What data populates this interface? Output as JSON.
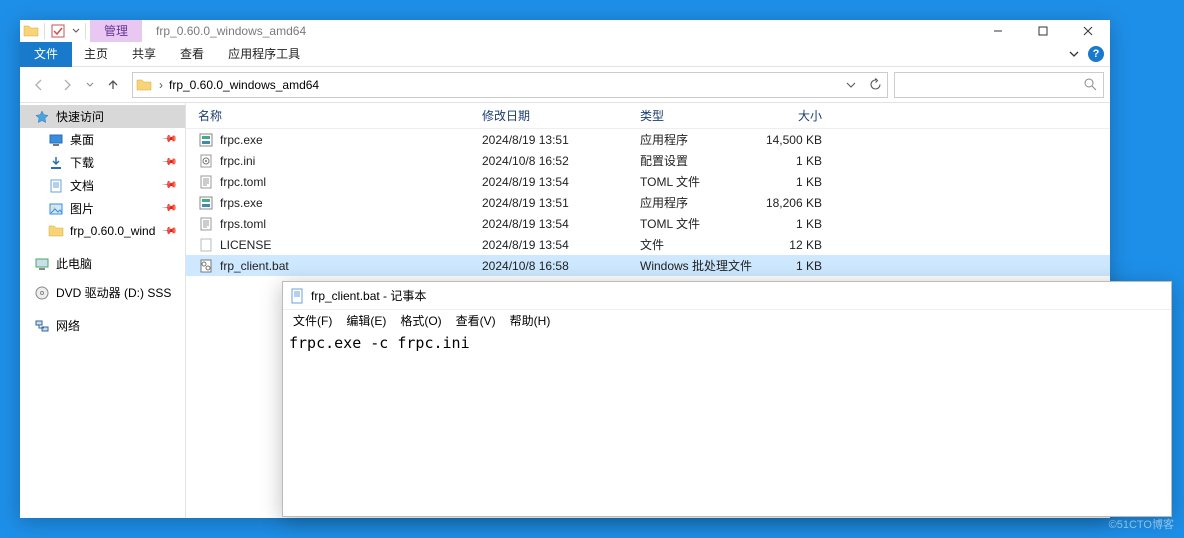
{
  "window": {
    "title": "frp_0.60.0_windows_amd64",
    "tool_tab": "管理",
    "file_tab": "文件",
    "tabs": [
      "主页",
      "共享",
      "查看",
      "应用程序工具"
    ]
  },
  "address": {
    "crumbs": [
      "frp_0.60.0_windows_amd64"
    ]
  },
  "sidebar": {
    "quick": "快速访问",
    "items": [
      {
        "label": "桌面",
        "icon": "desktop",
        "pin": true
      },
      {
        "label": "下载",
        "icon": "download",
        "pin": true
      },
      {
        "label": "文档",
        "icon": "document",
        "pin": true
      },
      {
        "label": "图片",
        "icon": "picture",
        "pin": true
      },
      {
        "label": "frp_0.60.0_wind",
        "icon": "folder",
        "pin": true
      }
    ],
    "thispc": "此电脑",
    "dvd": "DVD 驱动器 (D:) SSS",
    "network": "网络"
  },
  "columns": {
    "name": "名称",
    "date": "修改日期",
    "type": "类型",
    "size": "大小"
  },
  "files": [
    {
      "name": "frpc.exe",
      "date": "2024/8/19 13:51",
      "type": "应用程序",
      "size": "14,500 KB",
      "icon": "exe"
    },
    {
      "name": "frpc.ini",
      "date": "2024/10/8 16:52",
      "type": "配置设置",
      "size": "1 KB",
      "icon": "ini"
    },
    {
      "name": "frpc.toml",
      "date": "2024/8/19 13:54",
      "type": "TOML 文件",
      "size": "1 KB",
      "icon": "txt"
    },
    {
      "name": "frps.exe",
      "date": "2024/8/19 13:51",
      "type": "应用程序",
      "size": "18,206 KB",
      "icon": "exe"
    },
    {
      "name": "frps.toml",
      "date": "2024/8/19 13:54",
      "type": "TOML 文件",
      "size": "1 KB",
      "icon": "txt"
    },
    {
      "name": "LICENSE",
      "date": "2024/8/19 13:54",
      "type": "文件",
      "size": "12 KB",
      "icon": "file"
    },
    {
      "name": "frp_client.bat",
      "date": "2024/10/8 16:58",
      "type": "Windows 批处理文件",
      "size": "1 KB",
      "icon": "bat",
      "selected": true
    }
  ],
  "notepad": {
    "title": "frp_client.bat - 记事本",
    "menus": [
      "文件(F)",
      "编辑(E)",
      "格式(O)",
      "查看(V)",
      "帮助(H)"
    ],
    "content": "frpc.exe -c frpc.ini"
  },
  "watermark": "©51CTO博客"
}
